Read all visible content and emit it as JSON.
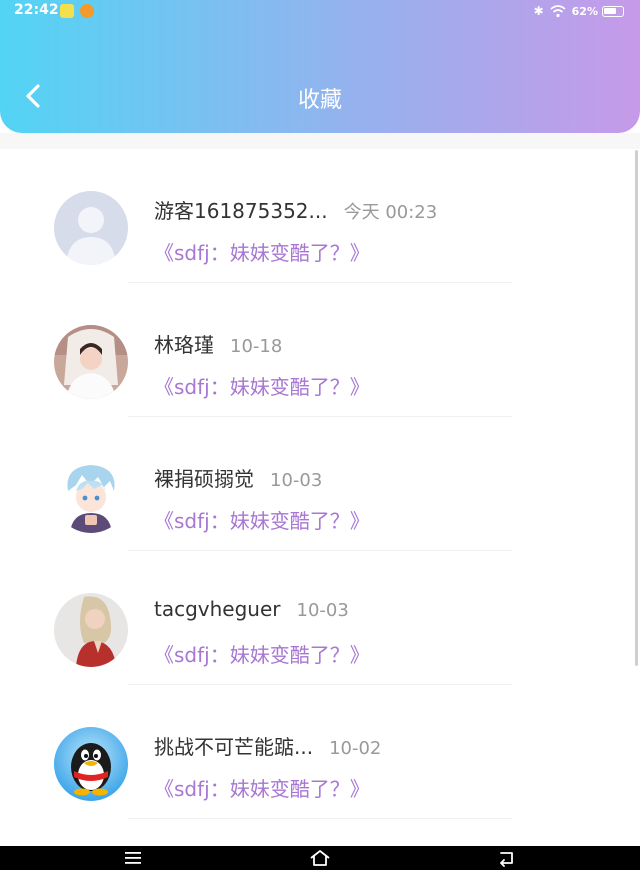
{
  "status_bar": {
    "time": "22:42",
    "battery": "62%"
  },
  "header": {
    "title": "收藏",
    "back_icon": "chevron-left-icon"
  },
  "items": [
    {
      "name": "游客161875352...",
      "time": "今天 00:23",
      "subtitle": "《sdfj：妹妹变酷了？》",
      "avatar": "default-avatar"
    },
    {
      "name": "林珞瑾",
      "time": "10-18",
      "subtitle": "《sdfj：妹妹变酷了？》",
      "avatar": "bride-photo"
    },
    {
      "name": "裸捐硕搦觉",
      "time": "10-03",
      "subtitle": "《sdfj：妹妹变酷了？》",
      "avatar": "anime-boy"
    },
    {
      "name": "tacgvheguer",
      "time": "10-03",
      "subtitle": "《sdfj：妹妹变酷了？》",
      "avatar": "woman-photo"
    },
    {
      "name": "挑战不可芒能踮...",
      "time": "10-02",
      "subtitle": "《sdfj：妹妹变酷了？》",
      "avatar": "qq-penguin"
    }
  ],
  "colors": {
    "header_gradient": [
      "#52d4f4",
      "#95b2ee",
      "#c69ae9"
    ],
    "subtitle": "#a777d3",
    "name": "#333333",
    "time": "#999999"
  }
}
